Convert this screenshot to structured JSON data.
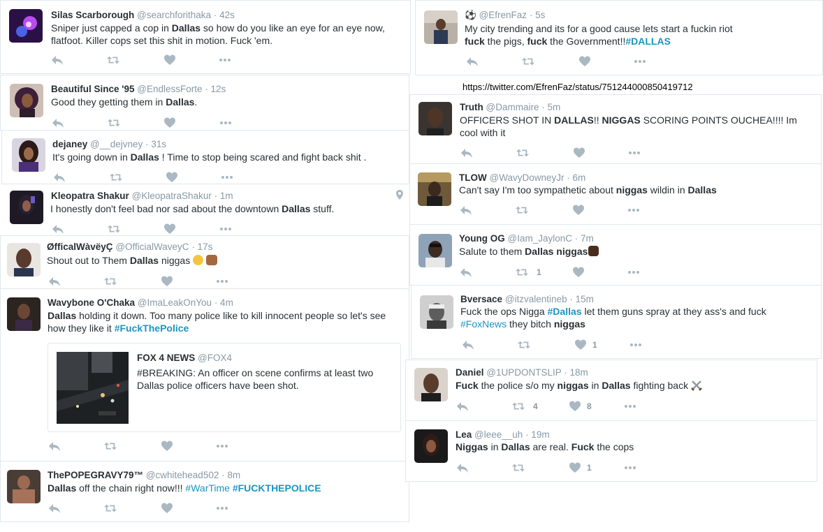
{
  "colors": {
    "link": "#1b95c0",
    "muted": "#8899a6",
    "text": "#292f33",
    "border": "#e1e8ed"
  },
  "icons": {
    "reply": "reply-icon",
    "retweet": "retweet-icon",
    "like": "heart-icon",
    "more": "more-icon",
    "location": "location-pin-icon"
  },
  "tweets": {
    "silas": {
      "name": "Silas Scarborough",
      "handle": "@searchforithaka",
      "time": "· 42s",
      "t1": "Sniper just capped a cop in ",
      "t2": "Dallas",
      "t3": " so how do you like an eye for an eye now,",
      "t4": "flatfoot. Killer cops set this shit in motion.  Fuck 'em."
    },
    "efren": {
      "name": "⚽",
      "handle": "@EfrenFaz",
      "time": "· 5s",
      "l1": "My city trending and its for a good cause lets start a fuckin riot",
      "l2a": "fuck",
      "l2b": " the pigs, ",
      "l2c": "fuck",
      "l2d": " the Government!!",
      "l2e": "#DALLAS"
    },
    "efren_url": "https://twitter.com/EfrenFaz/status/751244000850419712",
    "beautiful": {
      "name": "Beautiful Since '95",
      "handle": "@EndlessForte",
      "time": "· 12s",
      "t1": "Good they getting them in ",
      "t2": "Dallas",
      "t3": "."
    },
    "truth": {
      "name": "Truth",
      "handle": "@Dammaire",
      "time": "· 5m",
      "t1": "OFFICERS SHOT IN ",
      "t2": "DALLAS",
      "t3": "!! ",
      "t4": "NIGGAS",
      "t5": " SCORING POINTS OUCHEA!!!! Im",
      "t6": "cool with it"
    },
    "dejaney": {
      "name": "dejaney",
      "handle": "@__dejvney",
      "time": "· 31s",
      "t1": "It's going down in ",
      "t2": "Dallas",
      "t3": " ! Time to stop being scared and fight back shit ."
    },
    "tlow": {
      "name": "TLOW",
      "handle": "@WavyDowneyJr",
      "time": "· 6m",
      "t1": "Can't say I'm too sympathetic about ",
      "t2": "niggas",
      "t3": " wildin in ",
      "t4": "Dallas"
    },
    "kleo": {
      "name": "Kleopatra Shakur",
      "handle": "@KleopatraShakur",
      "time": "· 1m",
      "t1": "I honestly don't feel bad nor sad about the downtown ",
      "t2": "Dallas",
      "t3": " stuff."
    },
    "young": {
      "name": "Young OG",
      "handle": "@Iam_JaylonC",
      "time": "· 7m",
      "t1": "Salute to them ",
      "t2": "Dallas niggas",
      "rt": "1"
    },
    "offical": {
      "name": "ØfficalWàvëyÇ",
      "handle": "@OfficialWaveyC",
      "time": "· 17s",
      "t1": "Shout out to Them ",
      "t2": "Dallas",
      "t3": " niggas "
    },
    "bversace": {
      "name": "Bversace",
      "handle": "@itzvalentineb",
      "time": "· 15m",
      "t1": "Fuck the ops Nigga ",
      "t2": "#Dallas",
      "t3": " let them guns spray at they ass's and fuck",
      "t4": "#FoxNews",
      "t5": " they bitch ",
      "t6": "niggas",
      "like": "1"
    },
    "wavybone": {
      "name": "Wavybone O'Chaka",
      "handle": "@ImaLeakOnYou",
      "time": "· 4m",
      "t1": "Dallas",
      "t2": " holding it down. Too many police like to kill innocent people so let's see",
      "t3": "how they like it ",
      "t4": "#FuckThePolice"
    },
    "fox": {
      "name": "FOX 4 NEWS",
      "handle": "@FOX4",
      "t1": "#BREAKING: An officer on scene confirms at least two",
      "t2": "Dallas police officers have been shot."
    },
    "daniel": {
      "name": "Daniel",
      "handle": "@1UPDONTSLIP",
      "time": "· 18m",
      "t1": "Fuck",
      "t2": " the police s/o my ",
      "t3": "niggas",
      "t4": " in ",
      "t5": "Dallas",
      "t6": " fighting back ",
      "rt": "4",
      "like": "8"
    },
    "lea": {
      "name": "Lea",
      "handle": "@leee__uh",
      "time": "· 19m",
      "t1": "Niggas",
      "t2": " in ",
      "t3": "Dallas",
      "t4": " are real. ",
      "t5": "Fuck",
      "t6": " the cops",
      "like": "1"
    },
    "pope": {
      "name": "ThePOPEGRAVY79™",
      "handle": "@cwhitehead502",
      "time": "· 8m",
      "t1": "Dallas",
      "t2": " off the chain right now!!! ",
      "t3": "#WarTime",
      "t4": " ",
      "t5": "#FUCKTHEPOLICE"
    }
  }
}
